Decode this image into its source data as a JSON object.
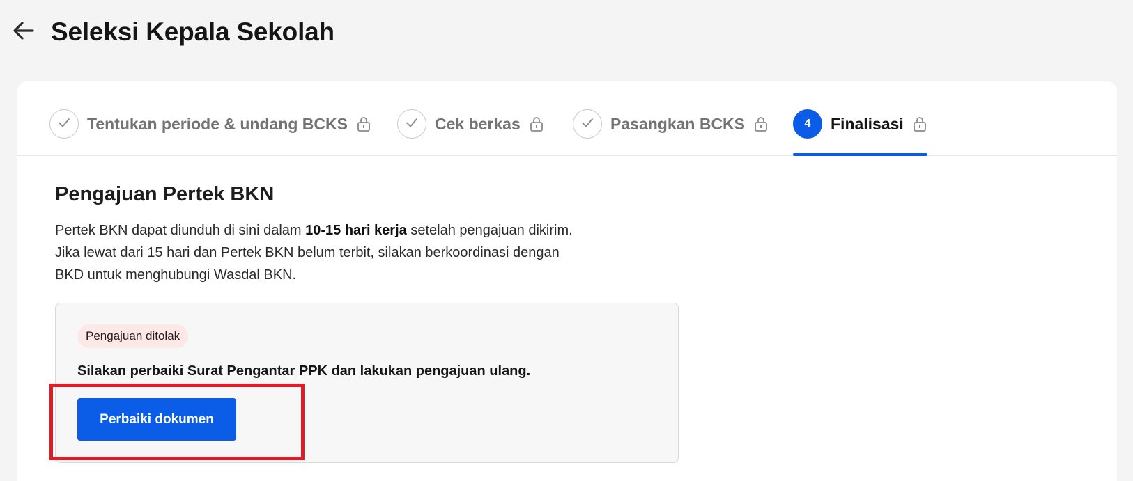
{
  "header": {
    "title": "Seleksi Kepala Sekolah",
    "back_icon": "arrow-left-icon"
  },
  "stepper": {
    "steps": [
      {
        "label": "Tentukan periode & undang BCKS",
        "state": "completed",
        "icon": "check-icon",
        "locked": true
      },
      {
        "label": "Cek berkas",
        "state": "completed",
        "icon": "check-icon",
        "locked": true
      },
      {
        "label": "Pasangkan BCKS",
        "state": "completed",
        "icon": "check-icon",
        "locked": true
      },
      {
        "number": "4",
        "label": "Finalisasi",
        "state": "active",
        "locked": true
      }
    ]
  },
  "section": {
    "title": "Pengajuan Pertek BKN",
    "description": {
      "part1": "Pertek BKN dapat diunduh di sini dalam ",
      "bold": "10-15 hari kerja",
      "part2": " setelah pengajuan dikirim.",
      "line2": "Jika lewat dari 15 hari dan Pertek BKN belum terbit, silakan berkoordinasi dengan",
      "line3": "BKD untuk menghubungi Wasdal BKN."
    }
  },
  "status_panel": {
    "badge": "Pengajuan ditolak",
    "message": "Silakan perbaiki Surat Pengantar PPK dan lakukan pengajuan ulang.",
    "button_label": "Perbaiki dokumen"
  },
  "colors": {
    "primary": "#0b5ce6",
    "badge_bg": "#fde8e8",
    "highlight": "#e21b26",
    "background": "#f4f4f4"
  }
}
